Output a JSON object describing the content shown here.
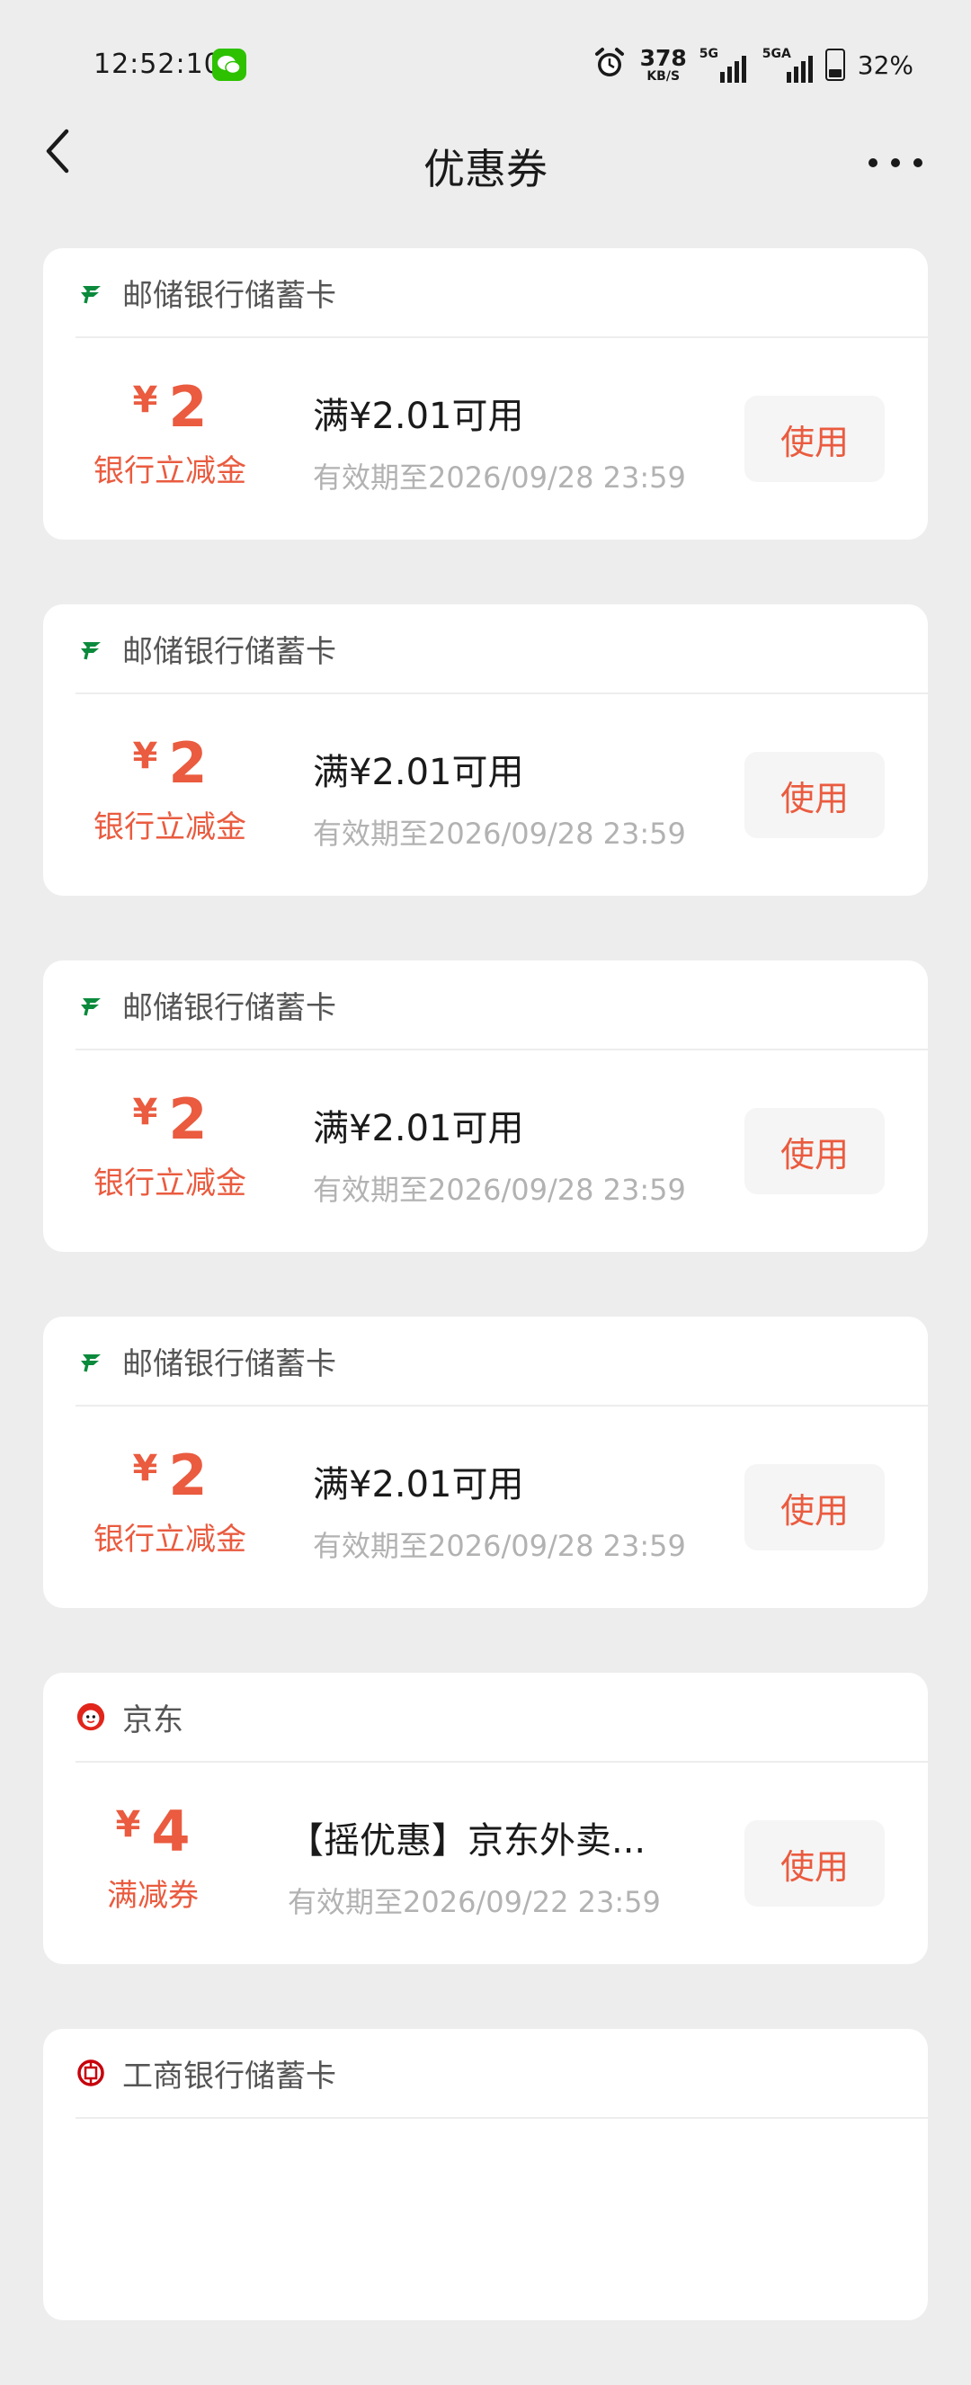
{
  "status_bar": {
    "time": "12:52:10",
    "net_speed_value": "378",
    "net_speed_unit": "KB/S",
    "signal1_label": "5G",
    "signal2_label": "5GA",
    "battery_text": "32%",
    "battery_level": 0.32,
    "wechat_color": "#2dc100"
  },
  "nav": {
    "title": "优惠券"
  },
  "colors": {
    "accent": "#ea5b3f",
    "card_bg": "#ffffff",
    "page_bg": "#ededed",
    "muted_text": "#b2b2b2"
  },
  "coupons": [
    {
      "issuer": "邮储银行储蓄卡",
      "issuer_icon": "psbc-logo-icon",
      "currency": "¥",
      "amount": "2",
      "type": "银行立减金",
      "condition": "满¥2.01可用",
      "validity": "有效期至2026/09/28  23:59",
      "action": "使用"
    },
    {
      "issuer": "邮储银行储蓄卡",
      "issuer_icon": "psbc-logo-icon",
      "currency": "¥",
      "amount": "2",
      "type": "银行立减金",
      "condition": "满¥2.01可用",
      "validity": "有效期至2026/09/28  23:59",
      "action": "使用"
    },
    {
      "issuer": "邮储银行储蓄卡",
      "issuer_icon": "psbc-logo-icon",
      "currency": "¥",
      "amount": "2",
      "type": "银行立减金",
      "condition": "满¥2.01可用",
      "validity": "有效期至2026/09/28  23:59",
      "action": "使用"
    },
    {
      "issuer": "邮储银行储蓄卡",
      "issuer_icon": "psbc-logo-icon",
      "currency": "¥",
      "amount": "2",
      "type": "银行立减金",
      "condition": "满¥2.01可用",
      "validity": "有效期至2026/09/28  23:59",
      "action": "使用"
    },
    {
      "issuer": "京东",
      "issuer_icon": "jd-logo-icon",
      "currency": "¥",
      "amount": "4",
      "type": "满减券",
      "condition": "【摇优惠】京东外卖...",
      "validity": "有效期至2026/09/22  23:59",
      "action": "使用"
    },
    {
      "issuer": "工商银行储蓄卡",
      "issuer_icon": "icbc-logo-icon"
    }
  ]
}
